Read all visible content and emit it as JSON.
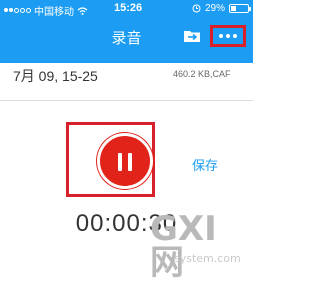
{
  "status_bar": {
    "carrier": "中国移动",
    "time": "15:26",
    "battery_text": "29%",
    "battery_level": 0.29
  },
  "app_bar": {
    "title": "录音",
    "folder_icon": "folder-transfer-icon",
    "more_icon": "more-dots-icon"
  },
  "recording": {
    "title": "7月 09, 15-25",
    "meta": "460.2 KB,CAF"
  },
  "controls": {
    "pause_icon": "pause-icon",
    "save_label": "保存",
    "timer": "00:00:30"
  },
  "watermark": {
    "logo": "GXI网",
    "url": "system.com"
  },
  "colors": {
    "accent": "#1c9df3",
    "record_red": "#e2231a",
    "highlight_red": "#d8202a"
  }
}
